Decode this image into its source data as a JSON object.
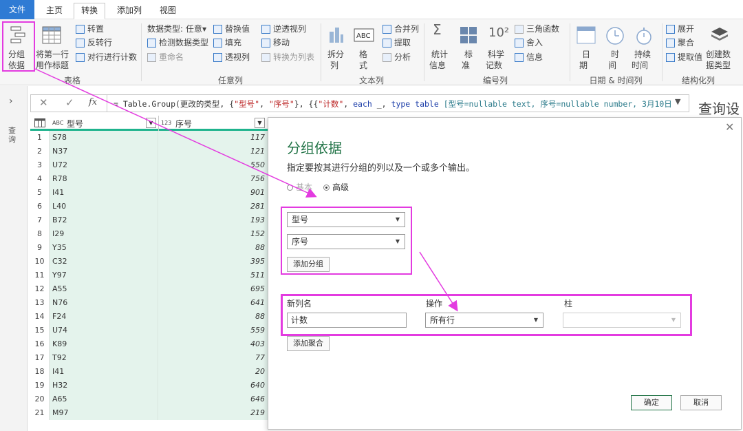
{
  "tabs": [
    "文件",
    "主页",
    "转换",
    "添加列",
    "视图"
  ],
  "ribbon": {
    "table": {
      "group_by_l1": "分组",
      "group_by_l2": "依据",
      "first_row_l1": "将第一行",
      "first_row_l2": "用作标题",
      "transpose": "转置",
      "reverse": "反转行",
      "count_rows": "对行进行计数",
      "group_label": "表格"
    },
    "any": {
      "data_type": "数据类型: 任意",
      "detect": "检测数据类型",
      "rename": "重命名",
      "replace": "替换值",
      "fill": "填充",
      "pivot": "透视列",
      "unpivot": "逆透视列",
      "move": "移动",
      "to_list": "转换为列表",
      "group_label": "任意列"
    },
    "text": {
      "split_l1": "拆分",
      "split_l2": "列",
      "format_l1": "格",
      "format_l2": "式",
      "merge": "合并列",
      "extract": "提取",
      "parse": "分析",
      "group_label": "文本列"
    },
    "number": {
      "stats_l1": "统计",
      "stats_l2": "信息",
      "std_l1": "标",
      "std_l2": "准",
      "sci_l1": "科学",
      "sci_l2": "记数",
      "trig": "三角函数",
      "round": "舍入",
      "info": "信息",
      "group_label": "编号列"
    },
    "datetime": {
      "date_l1": "日",
      "date_l2": "期",
      "time_l1": "时",
      "time_l2": "间",
      "dur_l1": "持续",
      "dur_l2": "时间",
      "group_label": "日期 & 时间列"
    },
    "struct": {
      "expand": "展开",
      "aggregate": "聚合",
      "extract_vals": "提取值",
      "create_l1": "创建数",
      "create_l2": "据类型",
      "group_label": "结构化列"
    }
  },
  "formula": {
    "p1": "= Table.Group(更改的类型, {",
    "s1": "\"型号\"",
    "p2": ", ",
    "s2": "\"序号\"",
    "p3": "}, {{",
    "s3": "\"计数\"",
    "p4": ", ",
    "k1": "each",
    "p5": " _, ",
    "k2": "type table",
    "t1": " [型号=nullable text, 序号=nullable number, 3月10日"
  },
  "query_settings": "查询设置",
  "left_rail_label": "查询",
  "grid": {
    "col1": "型号",
    "col2": "序号",
    "col1_type": "ABC",
    "col2_type": "123",
    "rows": [
      {
        "n": "1",
        "model": "S78",
        "seq": "117"
      },
      {
        "n": "2",
        "model": "N37",
        "seq": "121"
      },
      {
        "n": "3",
        "model": "U72",
        "seq": "550"
      },
      {
        "n": "4",
        "model": "R78",
        "seq": "756"
      },
      {
        "n": "5",
        "model": "I41",
        "seq": "901"
      },
      {
        "n": "6",
        "model": "L40",
        "seq": "281"
      },
      {
        "n": "7",
        "model": "B72",
        "seq": "193"
      },
      {
        "n": "8",
        "model": "I29",
        "seq": "152"
      },
      {
        "n": "9",
        "model": "Y35",
        "seq": "88"
      },
      {
        "n": "10",
        "model": "C32",
        "seq": "395"
      },
      {
        "n": "11",
        "model": "Y97",
        "seq": "511"
      },
      {
        "n": "12",
        "model": "A55",
        "seq": "695"
      },
      {
        "n": "13",
        "model": "N76",
        "seq": "641"
      },
      {
        "n": "14",
        "model": "F24",
        "seq": "88"
      },
      {
        "n": "15",
        "model": "U74",
        "seq": "559"
      },
      {
        "n": "16",
        "model": "K89",
        "seq": "403"
      },
      {
        "n": "17",
        "model": "T92",
        "seq": "77"
      },
      {
        "n": "18",
        "model": "I41",
        "seq": "20"
      },
      {
        "n": "19",
        "model": "H32",
        "seq": "640"
      },
      {
        "n": "20",
        "model": "A65",
        "seq": "646"
      },
      {
        "n": "21",
        "model": "M97",
        "seq": "219"
      }
    ]
  },
  "dialog": {
    "title": "分组依据",
    "description": "指定要按其进行分组的列以及一个或多个输出。",
    "radio_basic": "基本",
    "radio_advanced": "高级",
    "group1": "型号",
    "group2": "序号",
    "add_group": "添加分组",
    "label_new_col": "新列名",
    "label_op": "操作",
    "label_col": "柱",
    "new_col_value": "计数",
    "op_value": "所有行",
    "col_value": "",
    "add_agg": "添加聚合",
    "ok": "确定",
    "cancel": "取消",
    "close": "✕"
  },
  "colors": {
    "accent": "#217346",
    "file_tab": "#2f7bd4",
    "highlight": "#e33be0",
    "grid_fill": "#e4f3ec",
    "grid_header_line": "#1fb38d"
  }
}
